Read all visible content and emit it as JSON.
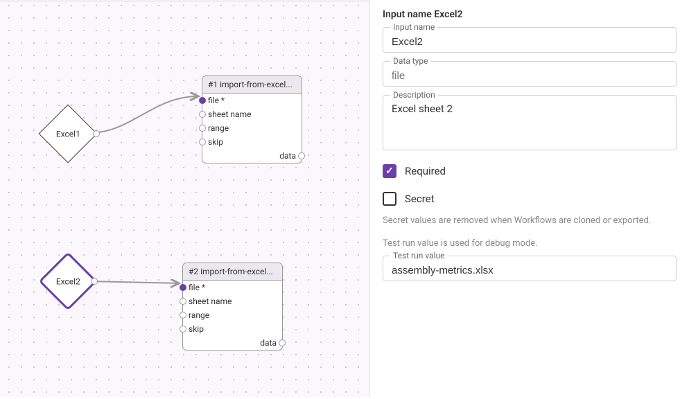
{
  "panel": {
    "title_prefix": "Input name ",
    "title_name": "Excel2",
    "input_name_label": "Input name",
    "input_name_value": "Excel2",
    "data_type_label": "Data type",
    "data_type_placeholder": "file",
    "description_label": "Description",
    "description_value": "Excel sheet 2",
    "required_label": "Required",
    "secret_label": "Secret",
    "secret_help": "Secret values are removed when Workflows are cloned or exported.",
    "test_help": "Test run value is used for debug mode.",
    "test_label": "Test run value",
    "test_value": "assembly-metrics.xlsx"
  },
  "canvas": {
    "nodes": {
      "excel1_label": "Excel1",
      "excel2_label": "Excel2",
      "block1_title": "#1 import-from-excel...",
      "block2_title": "#2 import-from-excel...",
      "port_file": "file *",
      "port_sheet": "sheet name",
      "port_range": "range",
      "port_skip": "skip",
      "port_data": "data"
    }
  }
}
